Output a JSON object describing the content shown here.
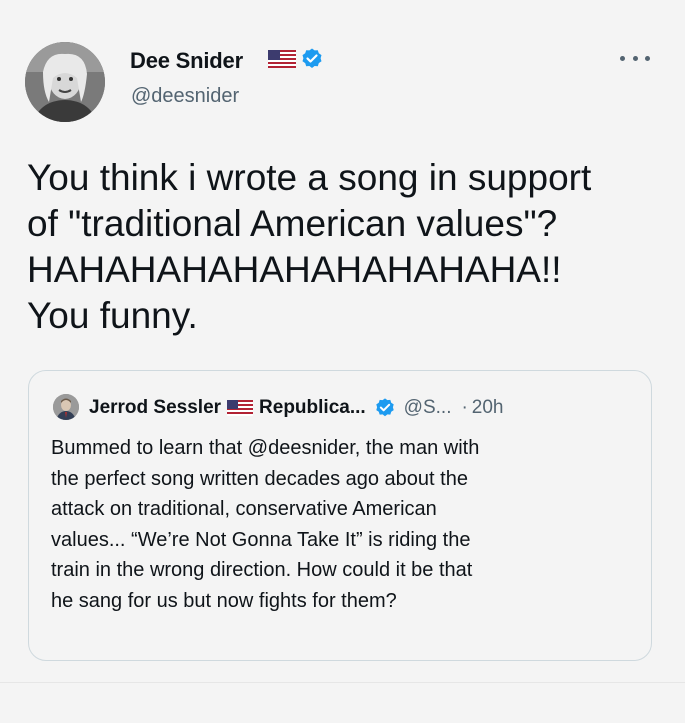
{
  "author": {
    "name": "Dee Snider",
    "handle": "@deesnider"
  },
  "tweet": {
    "lines": [
      "You think i wrote a song in support",
      "of \"traditional American values\"?",
      "HAHAHAHAHAHAHAHAHAHA!!",
      "You funny."
    ]
  },
  "quote": {
    "name": "Jerrod Sessler",
    "affiliation": "Republica...",
    "handle": "@S...",
    "separator": "·",
    "time": "20h",
    "lines": [
      "Bummed to learn that @deesnider, the man with",
      "the perfect song written decades ago about the",
      "attack on traditional, conservative American",
      "values... “We’re Not Gonna Take It” is riding the",
      "train in the wrong direction. How could it be that",
      "he sang for us but now fights for them?"
    ]
  },
  "colors": {
    "background": "#f4f4f4",
    "text": "#0f1419",
    "secondary": "#536471",
    "verified": "#1d9bf0",
    "border": "#cfd9de"
  },
  "icons": {
    "verified": "verified-badge-icon",
    "flag": "us-flag-icon",
    "more": "more-horizontal-icon"
  }
}
